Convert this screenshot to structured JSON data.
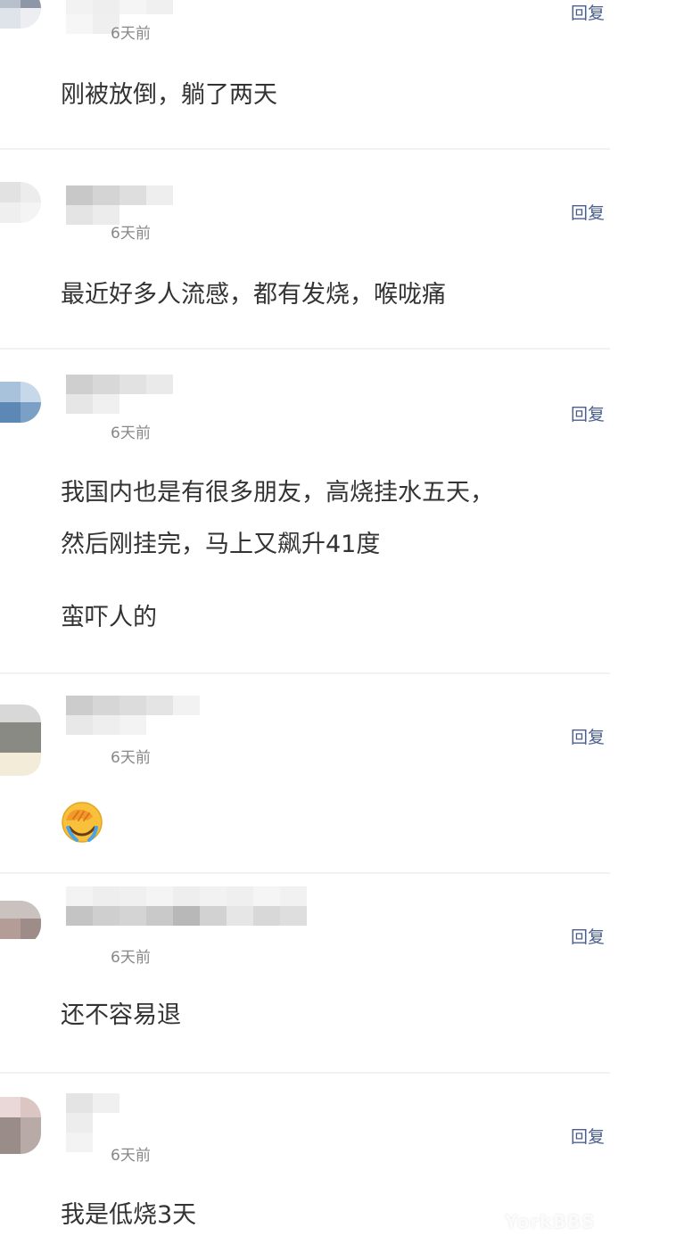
{
  "comments": [
    {
      "time": "6天前",
      "reply": "回复",
      "lines": [
        "刚被放倒，躺了两天"
      ]
    },
    {
      "time": "6天前",
      "reply": "回复",
      "lines": [
        "最近好多人流感，都有发烧，喉咙痛"
      ]
    },
    {
      "time": "6天前",
      "reply": "回复",
      "lines": [
        "我国内也是有很多朋友，高烧挂水五天，",
        "然后刚挂完，马上又飙升41度",
        "蛮吓人的"
      ]
    },
    {
      "time": "6天前",
      "reply": "回复",
      "emoji": "face-palm-emoji"
    },
    {
      "time": "6天前",
      "reply": "回复",
      "lines": [
        "还不容易退"
      ]
    },
    {
      "time": "6天前",
      "reply": "回复",
      "lines": [
        "我是低烧3天"
      ]
    }
  ],
  "watermark": "YorkBBS",
  "colors": {
    "reply": "#4a5f8c",
    "time": "#888888",
    "text": "#333333",
    "divider": "#f1f1f1"
  }
}
